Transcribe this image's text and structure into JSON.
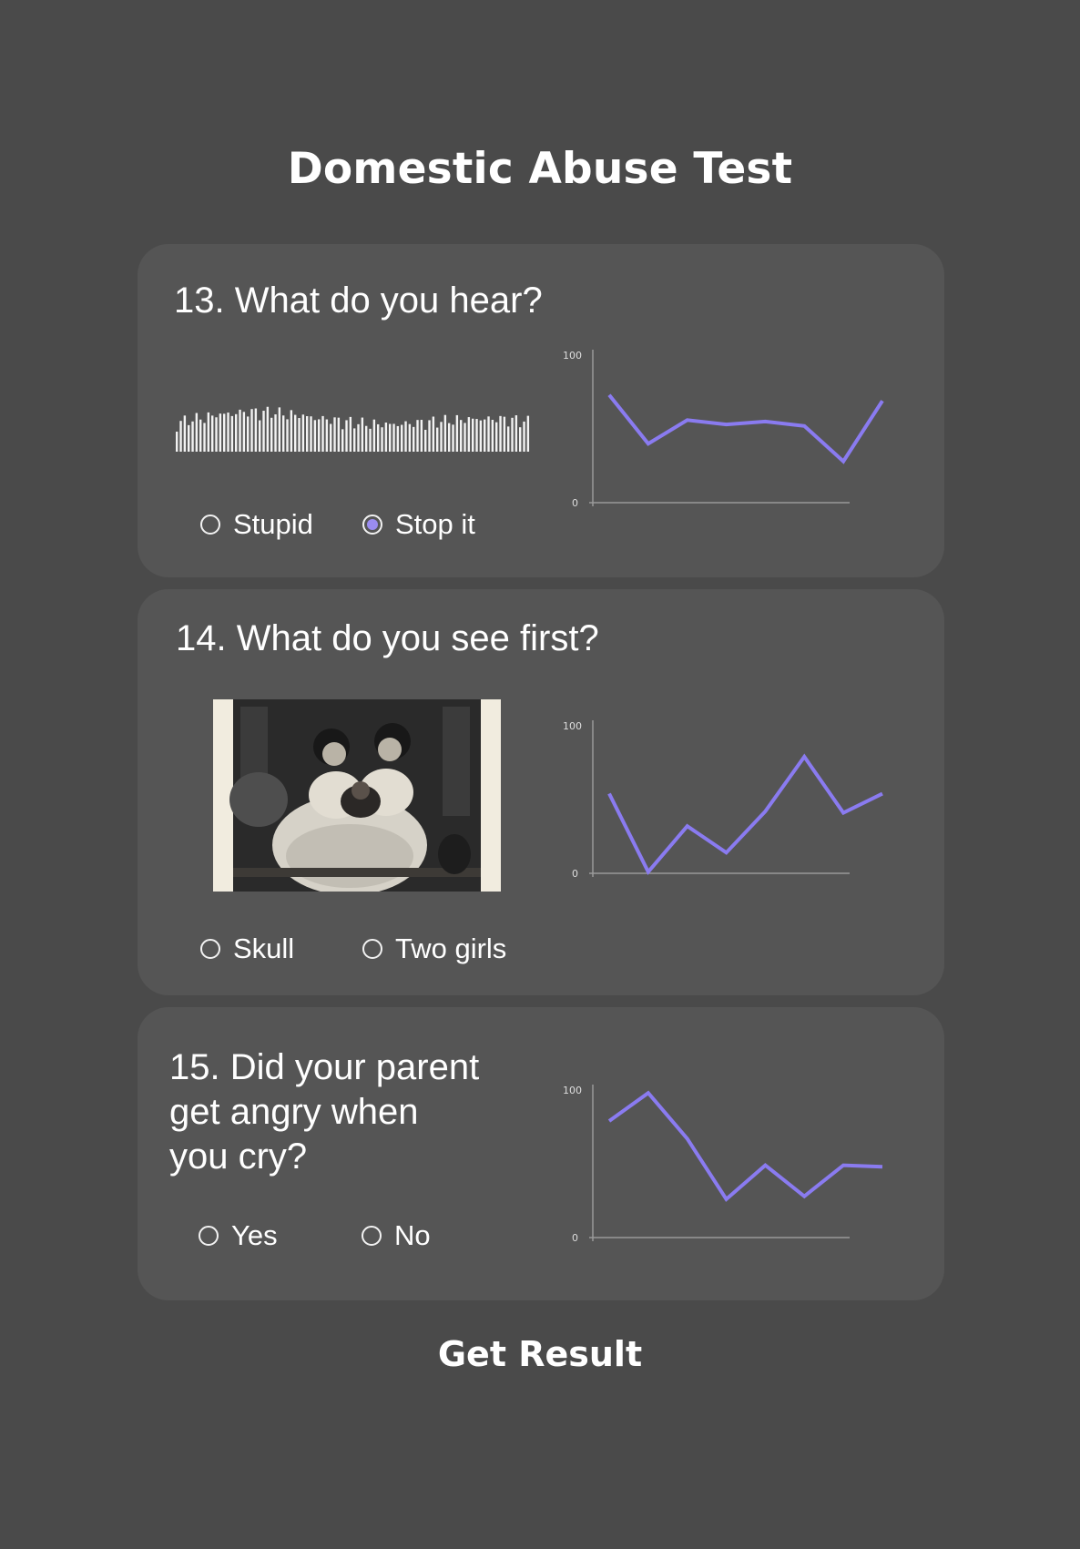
{
  "title": "Domestic Abuse Test",
  "accent_color": "#8a7bf0",
  "questions": [
    {
      "number": "13.",
      "text": "13. What do you hear?",
      "media": "audio-waveform",
      "options": [
        {
          "label": "Stupid",
          "selected": false
        },
        {
          "label": "Stop it",
          "selected": true
        }
      ],
      "chart_data": {
        "type": "line",
        "y_tick_labels": [
          "0",
          "100"
        ],
        "ylim": [
          0,
          100
        ],
        "x": [
          1,
          2,
          3,
          4,
          5,
          6,
          7,
          8
        ],
        "values": [
          73,
          40,
          56,
          53,
          55,
          52,
          28,
          69
        ],
        "grid": false
      }
    },
    {
      "number": "14.",
      "text": "14. What do you see first?",
      "media": "vintage-illustration-two-girls",
      "options": [
        {
          "label": "Skull",
          "selected": false
        },
        {
          "label": "Two girls",
          "selected": false
        }
      ],
      "chart_data": {
        "type": "line",
        "y_tick_labels": [
          "0",
          "100"
        ],
        "ylim": [
          0,
          100
        ],
        "x": [
          1,
          2,
          3,
          4,
          5,
          6,
          7,
          8
        ],
        "values": [
          54,
          1,
          32,
          14,
          42,
          79,
          41,
          54
        ],
        "grid": false
      }
    },
    {
      "number": "15.",
      "text_lines": [
        "15. Did your parent",
        "get angry when",
        "you cry?"
      ],
      "options": [
        {
          "label": "Yes",
          "selected": false
        },
        {
          "label": "No",
          "selected": false
        }
      ],
      "chart_data": {
        "type": "line",
        "y_tick_labels": [
          "0",
          "100"
        ],
        "ylim": [
          0,
          100
        ],
        "x": [
          1,
          2,
          3,
          4,
          5,
          6,
          7,
          8
        ],
        "values": [
          79,
          98,
          67,
          26,
          49,
          28,
          49,
          48
        ],
        "grid": false
      }
    }
  ],
  "submit_label": "Get Result"
}
